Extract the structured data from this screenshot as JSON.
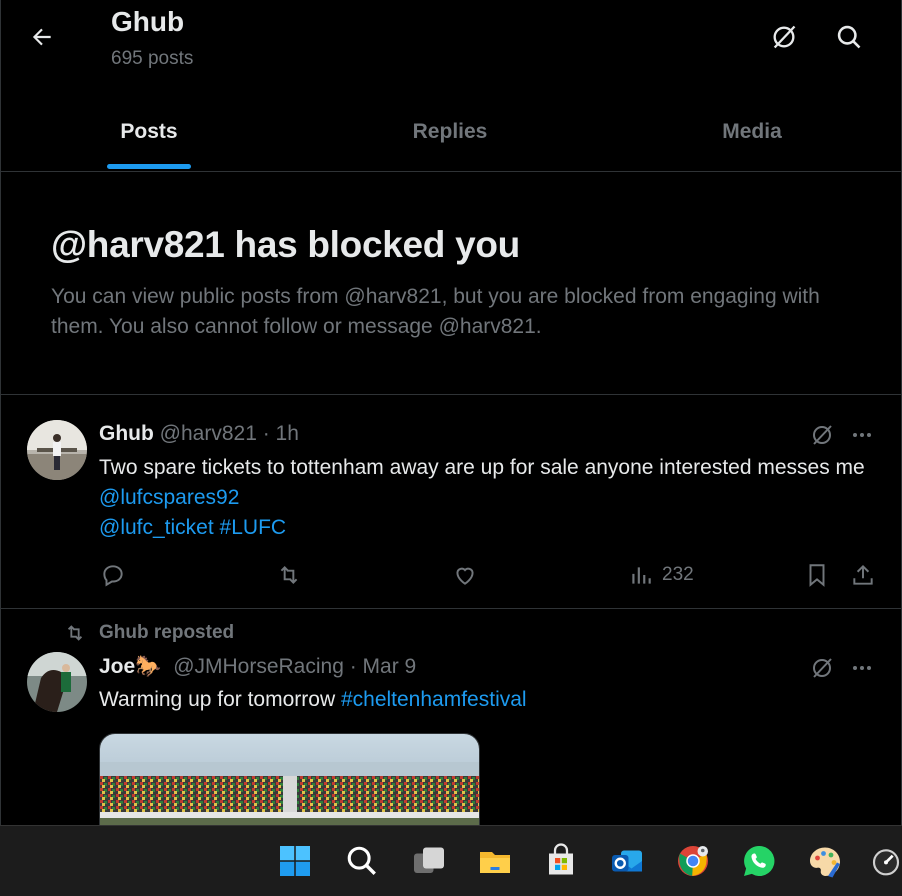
{
  "header": {
    "title": "Ghub",
    "post_count": "695 posts"
  },
  "tabs": [
    {
      "label": "Posts",
      "active": true
    },
    {
      "label": "Replies",
      "active": false
    },
    {
      "label": "Media",
      "active": false
    }
  ],
  "blocked": {
    "title": "@harv821 has blocked you",
    "message": "You can view public posts from @harv821, but you are blocked from engaging with them. You also cannot follow or message @harv821."
  },
  "tweet1": {
    "name": "Ghub",
    "meta": "@harv821 · 1h",
    "text": "Two spare tickets to tottenham away are up for sale anyone interested messes me",
    "mention1": "@lufcspares92",
    "mention2": "@lufc_ticket",
    "hashtag": "#LUFC",
    "views": "232"
  },
  "tweet2": {
    "reposted_by": "Ghub reposted",
    "name": "Joe",
    "name_emoji": "🐎",
    "meta": "@JMHorseRacing · Mar 9",
    "text": "Warming up for tomorrow",
    "hashtag": "#cheltenhamfestival"
  },
  "colors": {
    "accent": "#1d9bf0",
    "muted": "#71767b",
    "text": "#e7e9ea",
    "border": "#2f3336"
  },
  "taskbar": {
    "icons": [
      "windows-start-icon",
      "search-icon",
      "task-view-icon",
      "file-explorer-icon",
      "microsoft-store-icon",
      "outlook-icon",
      "chrome-icon",
      "whatsapp-icon",
      "paint-icon",
      "speedometer-icon"
    ]
  }
}
